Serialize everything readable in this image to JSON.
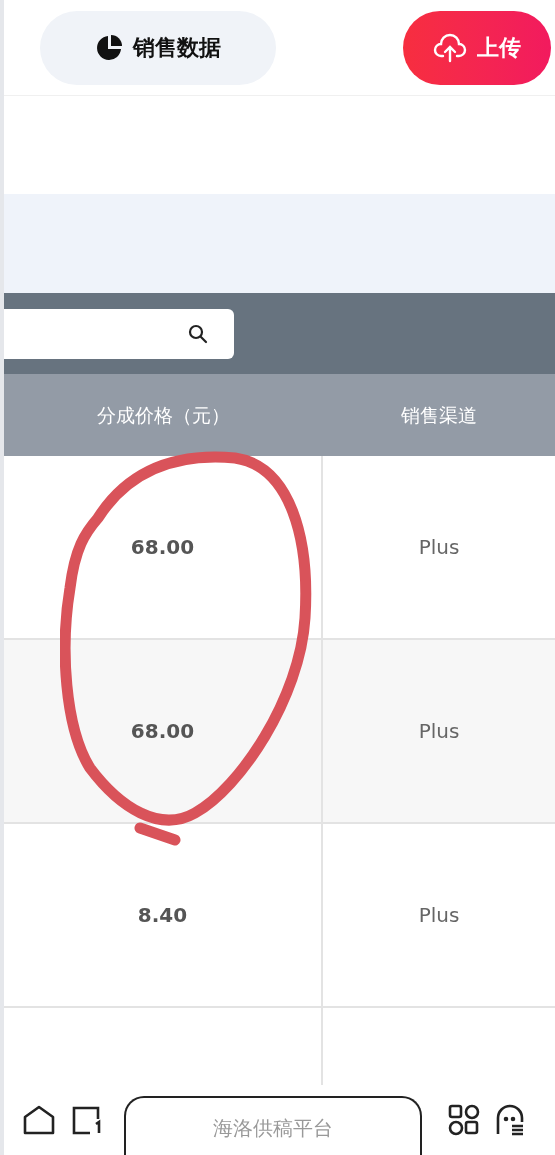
{
  "top_bar": {
    "sales_button": "销售数据",
    "upload_button": "上传"
  },
  "table": {
    "columns": [
      "分成价格（元）",
      "销售渠道"
    ],
    "rows": [
      {
        "price": "68.00",
        "channel": "Plus"
      },
      {
        "price": "68.00",
        "channel": "Plus"
      },
      {
        "price": "8.40",
        "channel": "Plus"
      }
    ]
  },
  "browser_bar": {
    "address": "海洛供稿平台"
  }
}
